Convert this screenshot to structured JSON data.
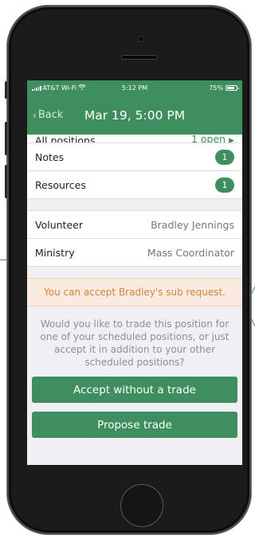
{
  "status_bar": {
    "carrier": "AT&T Wi-Fi",
    "time": "5:12 PM",
    "battery": "75%"
  },
  "nav": {
    "back_label": "Back",
    "title": "Mar 19, 5:00 PM"
  },
  "rows_top": [
    {
      "label": "All positions",
      "value": "1 open"
    },
    {
      "label": "Notes",
      "badge": "1"
    },
    {
      "label": "Resources",
      "badge": "1"
    }
  ],
  "rows_detail": [
    {
      "label": "Volunteer",
      "value": "Bradley Jennings"
    },
    {
      "label": "Ministry",
      "value": "Mass Coordinator"
    }
  ],
  "notice": "You can accept Bradley's sub request.",
  "question": "Would you like to trade this position for one of your scheduled positions, or just accept it in addition to your other scheduled positions?",
  "buttons": {
    "accept": "Accept without a trade",
    "propose": "Propose trade"
  },
  "colors": {
    "accent": "#3f8e5f",
    "notice_bg": "#fbeadf",
    "notice_text": "#d9823b"
  },
  "icons": [
    "wifi-icon",
    "signal-icon",
    "battery-icon",
    "chevron-left-icon",
    "chevron-right-icon"
  ]
}
